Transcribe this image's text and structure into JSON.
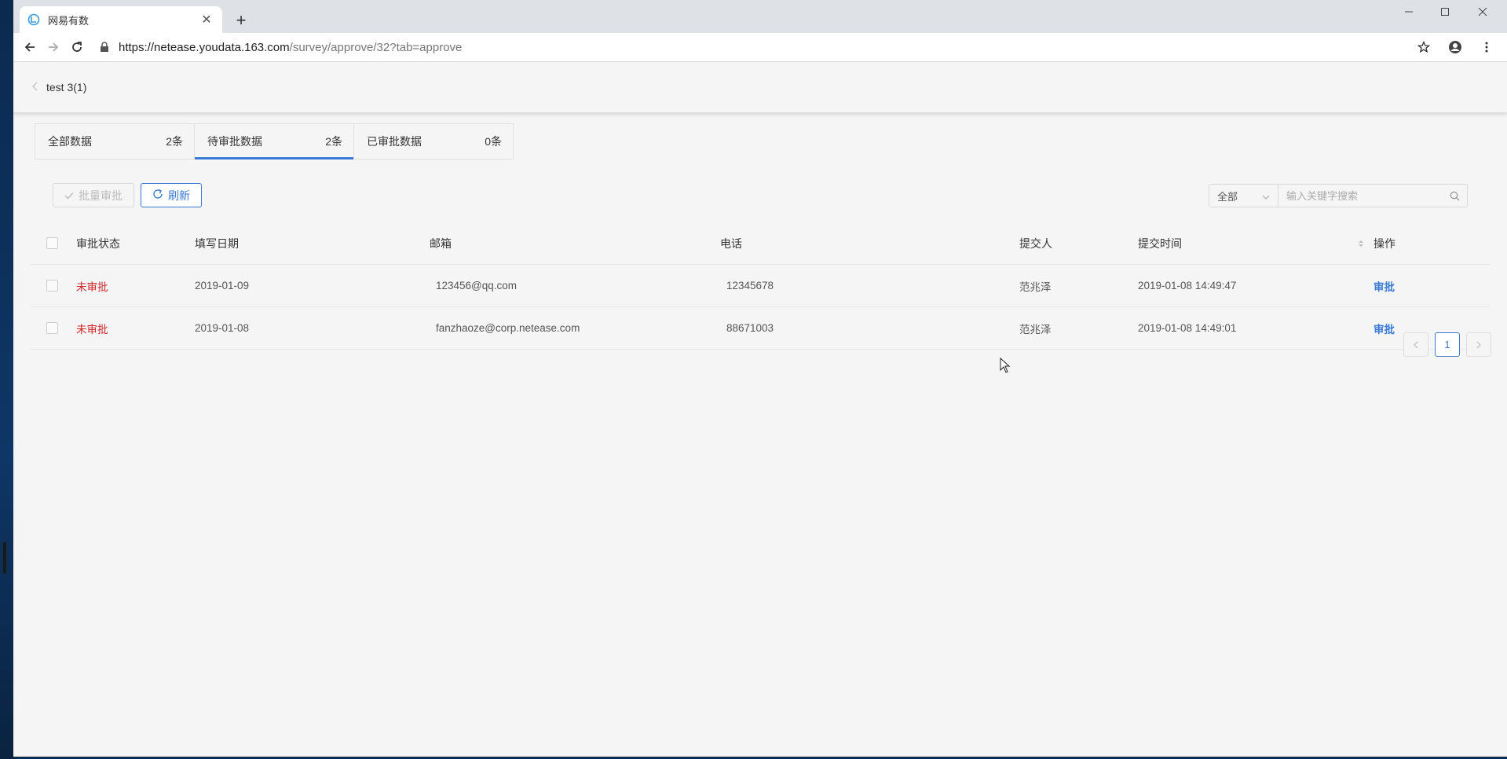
{
  "browser": {
    "tab_title": "网易有数",
    "url_host": "https://netease.youdata.163.com",
    "url_path": "/survey/approve/32?tab=approve"
  },
  "header": {
    "title": "test 3(1)"
  },
  "stat_tabs": [
    {
      "label": "全部数据",
      "count": "2条"
    },
    {
      "label": "待审批数据",
      "count": "2条"
    },
    {
      "label": "已审批数据",
      "count": "0条"
    }
  ],
  "toolbar": {
    "batch_label": "批量审批",
    "refresh_label": "刷新",
    "filter_value": "全部",
    "search_placeholder": "输入关键字搜索"
  },
  "table": {
    "columns": {
      "status": "审批状态",
      "date": "填写日期",
      "email": "邮箱",
      "phone": "电话",
      "submitter": "提交人",
      "time": "提交时间",
      "op": "操作"
    },
    "rows": [
      {
        "status": "未审批",
        "date": "2019-01-09",
        "email": "123456@qq.com",
        "phone": "12345678",
        "submitter": "范兆泽",
        "time": "2019-01-08 14:49:47",
        "op": "审批"
      },
      {
        "status": "未审批",
        "date": "2019-01-08",
        "email": "fanzhaoze@corp.netease.com",
        "phone": "88671003",
        "submitter": "范兆泽",
        "time": "2019-01-08 14:49:01",
        "op": "审批"
      }
    ]
  },
  "pagination": {
    "current": "1"
  },
  "colors": {
    "accent": "#3a7bd5",
    "pending": "#d0282b"
  }
}
